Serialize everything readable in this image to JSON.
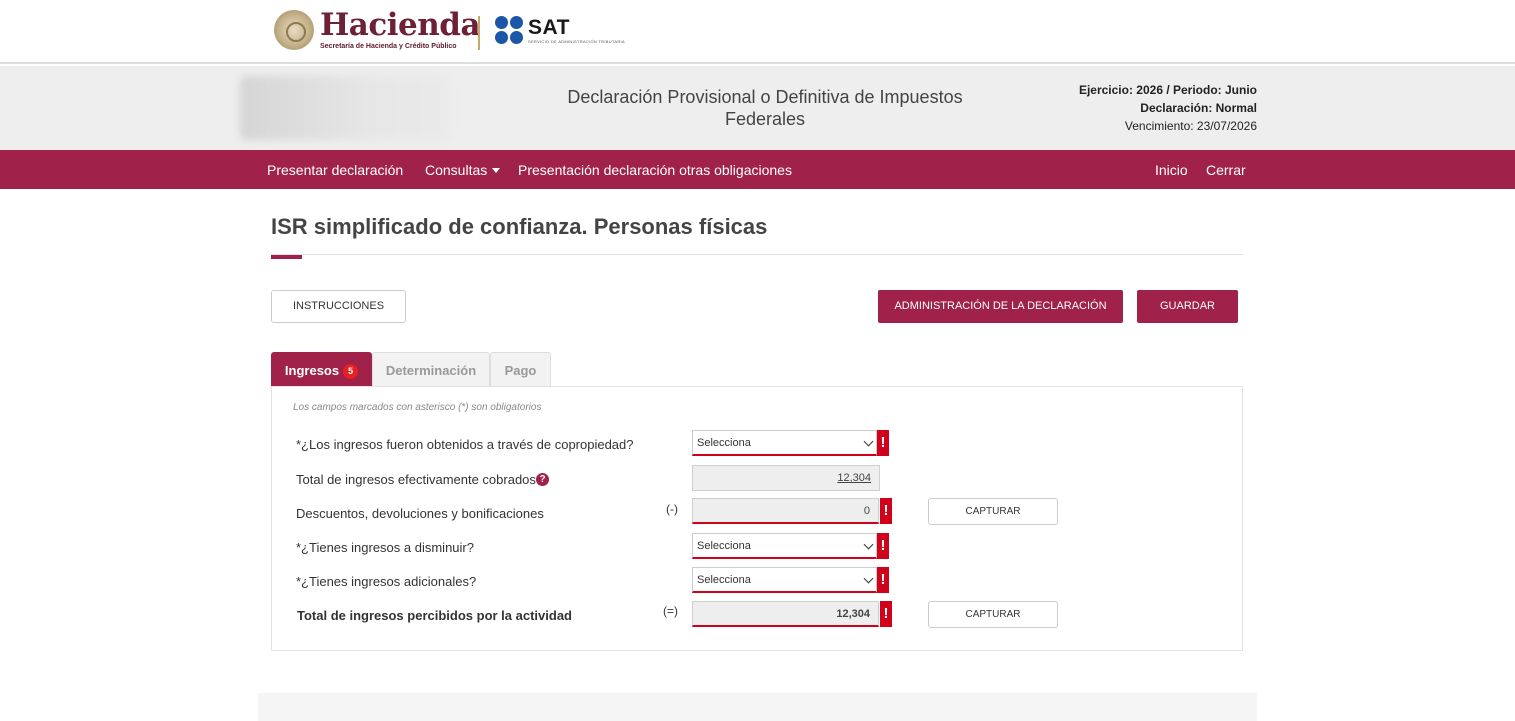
{
  "brand": {
    "hacienda_word": "Hacienda",
    "hacienda_sub": "Secretaría de Hacienda y Crédito Público",
    "sat_word": "SAT",
    "sat_sub": "SERVICIO DE ADMINISTRACIÓN TRIBUTARIA"
  },
  "header": {
    "title": "Declaración Provisional o Definitiva de Impuestos Federales",
    "ejercicio": "Ejercicio: 2026 / Periodo: Junio",
    "declaracion": "Declaración: Normal",
    "vencimiento": "Vencimiento: 23/07/2026"
  },
  "nav": {
    "presentar": "Presentar declaración",
    "consultas": "Consultas",
    "otras": "Presentación declaración otras obligaciones",
    "inicio": "Inicio",
    "cerrar": "Cerrar"
  },
  "page": {
    "title": "ISR simplificado de confianza. Personas físicas"
  },
  "actions": {
    "instrucciones": "INSTRUCCIONES",
    "administracion": "ADMINISTRACIÓN DE LA DECLARACIÓN",
    "guardar": "GUARDAR"
  },
  "tabs": {
    "ingresos": "Ingresos",
    "ingresos_badge": "5",
    "determinacion": "Determinación",
    "pago": "Pago"
  },
  "form": {
    "note": "Los campos marcados con asterisco (*) son obligatorios",
    "copropiedad_label": "*¿Los ingresos fueron obtenidos a través de copropiedad?",
    "copropiedad_value": "Selecciona",
    "total_cobrados_label": "Total de ingresos efectivamente cobrados",
    "total_cobrados_value": "12,304",
    "descuentos_label": "Descuentos, devoluciones y bonificaciones",
    "descuentos_sign": "(-)",
    "descuentos_value": "0",
    "disminuir_label": "*¿Tienes ingresos a disminuir?",
    "disminuir_value": "Selecciona",
    "adicionales_label": "*¿Tienes ingresos adicionales?",
    "adicionales_value": "Selecciona",
    "total_percibidos_label": "Total de ingresos percibidos por la actividad",
    "total_percibidos_sign": "(=)",
    "total_percibidos_value": "12,304",
    "capturar": "CAPTURAR",
    "excl": "!",
    "help": "?"
  },
  "colors": {
    "primary": "#a0224a",
    "error": "#d0021b",
    "sat_blue": "#1b57a6"
  }
}
